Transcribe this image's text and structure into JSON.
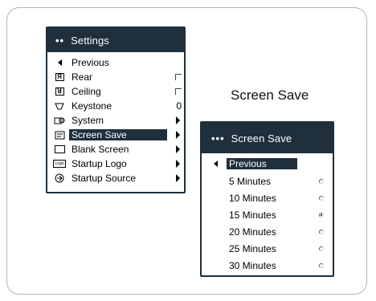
{
  "settings_menu": {
    "title": "Settings",
    "header_dots": "••",
    "items": [
      {
        "label": "Previous",
        "icon": "back-arrow-icon"
      },
      {
        "label": "Rear",
        "icon": "rear-projection-icon",
        "icon_glyph": "Я"
      },
      {
        "label": "Ceiling",
        "icon": "ceiling-mount-icon",
        "icon_glyph": "ꓤ"
      },
      {
        "label": "Keystone",
        "icon": "keystone-icon",
        "value": "0"
      },
      {
        "label": "System",
        "icon": "system-icon"
      },
      {
        "label": "Screen Save",
        "icon": "screen-save-icon",
        "selected": true
      },
      {
        "label": "Blank Screen",
        "icon": "blank-screen-icon"
      },
      {
        "label": "Startup Logo",
        "icon": "startup-logo-icon",
        "icon_glyph": "Logo"
      },
      {
        "label": "Startup Source",
        "icon": "startup-source-icon"
      }
    ]
  },
  "caption": "Screen Save",
  "screen_save_menu": {
    "title": "Screen Save",
    "header_dots": "•••",
    "items": [
      {
        "label": "Previous",
        "selected": true
      },
      {
        "label": "5 Minutes",
        "checked": false
      },
      {
        "label": "10 Minutes",
        "checked": false
      },
      {
        "label": "15 Minutes",
        "checked": true
      },
      {
        "label": "20 Minutes",
        "checked": false
      },
      {
        "label": "25 Minutes",
        "checked": false
      },
      {
        "label": "30 Minutes",
        "checked": false
      }
    ]
  },
  "colors": {
    "menu_dark": "#1f2f3c",
    "frame_border": "#b4b4b4"
  }
}
